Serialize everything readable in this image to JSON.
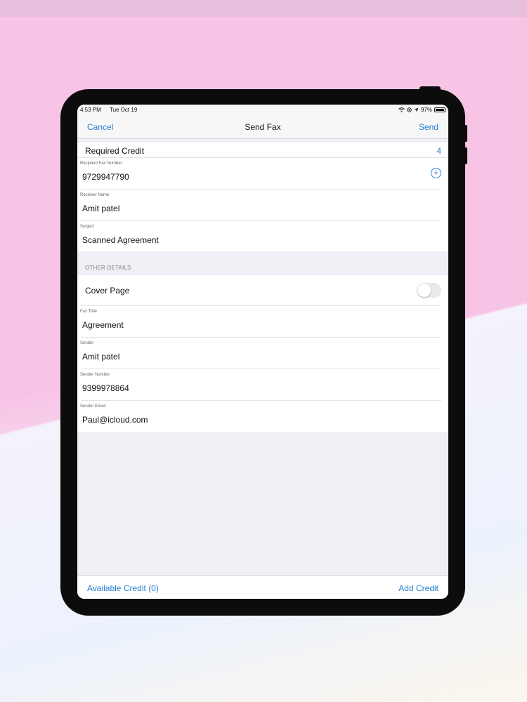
{
  "status": {
    "time": "4:53 PM",
    "date": "Tue Oct 19",
    "battery": "97%"
  },
  "nav": {
    "cancel": "Cancel",
    "title": "Send Fax",
    "send": "Send"
  },
  "required_credit": {
    "label": "Required Credit",
    "value": "4"
  },
  "fields": {
    "recipient_fax": {
      "label": "Recipient Fax Number",
      "value": "9729947790"
    },
    "receiver_name": {
      "label": "Receiver Name",
      "value": "Amit patel"
    },
    "subject": {
      "label": "Subject",
      "value": "Scanned Agreement"
    }
  },
  "other_details": {
    "header": "OTHER DETAILS",
    "cover_page": {
      "label": "Cover Page",
      "on": false
    },
    "fax_title": {
      "label": "Fax Tiltle",
      "value": "Agreement"
    },
    "sender": {
      "label": "Sender",
      "value": "Amit patel"
    },
    "sender_number": {
      "label": "Sender Number",
      "value": "9399978864"
    },
    "sender_email": {
      "label": "Sender Email",
      "value": "Paul@icloud.com"
    }
  },
  "bottom": {
    "available_credit": "Available Credit (0)",
    "add_credit": "Add Credit"
  },
  "colors": {
    "accent": "#2a7fd4",
    "background_pink": "#f8c4e6",
    "device": "#0c0c0c"
  },
  "icons": {
    "add": "plus-circle-icon",
    "wifi": "wifi-icon",
    "location": "location-arrow-icon",
    "battery": "battery-icon"
  }
}
